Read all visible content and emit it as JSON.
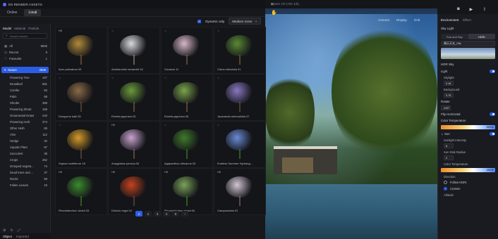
{
  "app": {
    "title": "D5 RENDER ASSETS",
    "window_buttons": [
      "—",
      "▢",
      "✕"
    ]
  },
  "top_tabs": [
    {
      "label": "Online"
    },
    {
      "label": "Local"
    }
  ],
  "sub_tabs": [
    {
      "label": "Model"
    },
    {
      "label": "Material"
    },
    {
      "label": "Particle"
    }
  ],
  "search": {
    "placeholder": "Search Assets"
  },
  "categories": [
    {
      "label": "All",
      "count": "8605"
    },
    {
      "label": "Recent",
      "count": "9"
    },
    {
      "label": "Favourite",
      "count": "1"
    }
  ],
  "nature": {
    "label": "Nature",
    "count": "2609"
  },
  "subcategories": [
    {
      "label": "Flowering Tree",
      "count": "187"
    },
    {
      "label": "Broadleaf",
      "count": "581"
    },
    {
      "label": "Conifer",
      "count": "83"
    },
    {
      "label": "Palm",
      "count": "88"
    },
    {
      "label": "Shrubs",
      "count": "388"
    },
    {
      "label": "Flowering Shrub",
      "count": "156"
    },
    {
      "label": "Ornamental Grass",
      "count": "240"
    },
    {
      "label": "Flowering Herb",
      "count": "374"
    },
    {
      "label": "Other Herb",
      "count": "65"
    },
    {
      "label": "Vine",
      "count": "112"
    },
    {
      "label": "Hedge",
      "count": "32"
    },
    {
      "label": "Aquatic Plant",
      "count": "87"
    },
    {
      "label": "Succulent",
      "count": "38"
    },
    {
      "label": "Crops",
      "count": "252"
    },
    {
      "label": "Grouped vegeta...",
      "count": "74"
    },
    {
      "label": "Dead trees and ...",
      "count": "37"
    },
    {
      "label": "Rocks",
      "count": "58"
    },
    {
      "label": "Fallen Leaves",
      "count": "43"
    }
  ],
  "left_bottom_tabs": [
    {
      "label": "Object"
    },
    {
      "label": "Imported"
    }
  ],
  "content_bar": {
    "dynamic_label": "Dynamic only",
    "icon_size": "Medium Icons"
  },
  "assets": [
    {
      "name": "Acer palmatum 08",
      "badge": "HD",
      "crown": "#b08a3a",
      "trunk": "#5b4330"
    },
    {
      "name": "Amelanchier lamarckii 04",
      "badge": "☆",
      "crown": "#d9d9dc",
      "trunk": "#6a5a50"
    },
    {
      "name": "Cerasus 11",
      "badge": "☆",
      "crown": "#d7b7c9",
      "trunk": "#574536"
    },
    {
      "name": "Citrus reticulata 01",
      "badge": "☆",
      "crown": "#5a8a34",
      "trunk": "#5b4330"
    },
    {
      "name": "Diospyros kaki 05",
      "badge": "☆",
      "crown": "#8a6a48",
      "trunk": "#4c3a2c"
    },
    {
      "name": "Ehretia japonica 03",
      "badge": "☆",
      "crown": "#6a9a3c",
      "trunk": "#5b4330"
    },
    {
      "name": "Ehretia japonica 05",
      "badge": "☆",
      "crown": "#7aa44a",
      "trunk": "#5b4330"
    },
    {
      "name": "Jacaranda mimosifolia 07",
      "badge": "☆",
      "crown": "#8a78c0",
      "trunk": "#4c3a2c"
    },
    {
      "name": "Sapium sebiferum 18",
      "badge": "☆",
      "crown": "#d49a2a",
      "trunk": "#4c3a2c"
    },
    {
      "name": "Amygdalus persica 06",
      "badge": "HD",
      "crown": "#c7a3cf",
      "trunk": "#5b4330"
    },
    {
      "name": "Agapanthus africanus 03",
      "badge": "☆",
      "crown": "#3f7a2c",
      "trunk": "#2f5a20"
    },
    {
      "name": "Endless Summer Hydrang...",
      "badge": "☆",
      "crown": "#6a8ad6",
      "trunk": "#2f5a20"
    },
    {
      "name": "Rhododendron simsii 03",
      "badge": "HD",
      "crown": "#3c8a2e",
      "trunk": "#2f5a20"
    },
    {
      "name": "Delonix regia 04",
      "badge": "HD",
      "crown": "#c4431f",
      "trunk": "#4c3a2c"
    },
    {
      "name": "Rhododendron simsii 04",
      "badge": "HD",
      "crown": "#7aa25a",
      "trunk": "#2f5a20"
    },
    {
      "name": "Campanulata 02",
      "badge": "HD",
      "crown": "#d2c6d4",
      "trunk": "#5b4a40"
    }
  ],
  "pagination": [
    {
      "label": "1"
    },
    {
      "label": "2"
    },
    {
      "label": "3"
    },
    {
      "label": "4"
    },
    {
      "label": "5"
    },
    {
      "label": "›"
    }
  ],
  "viewport": {
    "frame_label": "Frame 1/0 (720 1/6)",
    "toolbar": [
      {
        "label": "Camera"
      },
      {
        "label": "Display"
      },
      {
        "label": "Grid"
      }
    ]
  },
  "panel": {
    "tabs": [
      {
        "label": "Environment"
      },
      {
        "label": "Effect"
      }
    ],
    "sky_light": "Sky Light",
    "sky_modes": [
      {
        "label": "Sun and Sky"
      },
      {
        "label": "HDRI"
      }
    ],
    "hdri_name": "晴天天光_09k",
    "hdr_sky": "HDR Sky",
    "light": "Light",
    "skylight": "Skylight",
    "skylight_value": "0.18",
    "background": "Background",
    "background_value": "0.75",
    "rotate": "Rotate",
    "rotate_value": "-133°",
    "flip_horizontal": "Flip Horizontal",
    "color_temperature": "Color Temperature",
    "color_temperature_value": "6500K",
    "sun": "Sun",
    "sunlight_intensity": "Sunlight Intensity",
    "sunlight_intensity_value": "6",
    "sun_disk_radius": "Sun Disk Radius",
    "sun_disk_radius_value": "2",
    "color_temperature_2": "Color Temperature",
    "color_temperature_2_value": "4500K",
    "direction": "Direction",
    "follow_hdri": "Follow HDRI",
    "custom": "Custom",
    "altitude": "Altitude"
  }
}
